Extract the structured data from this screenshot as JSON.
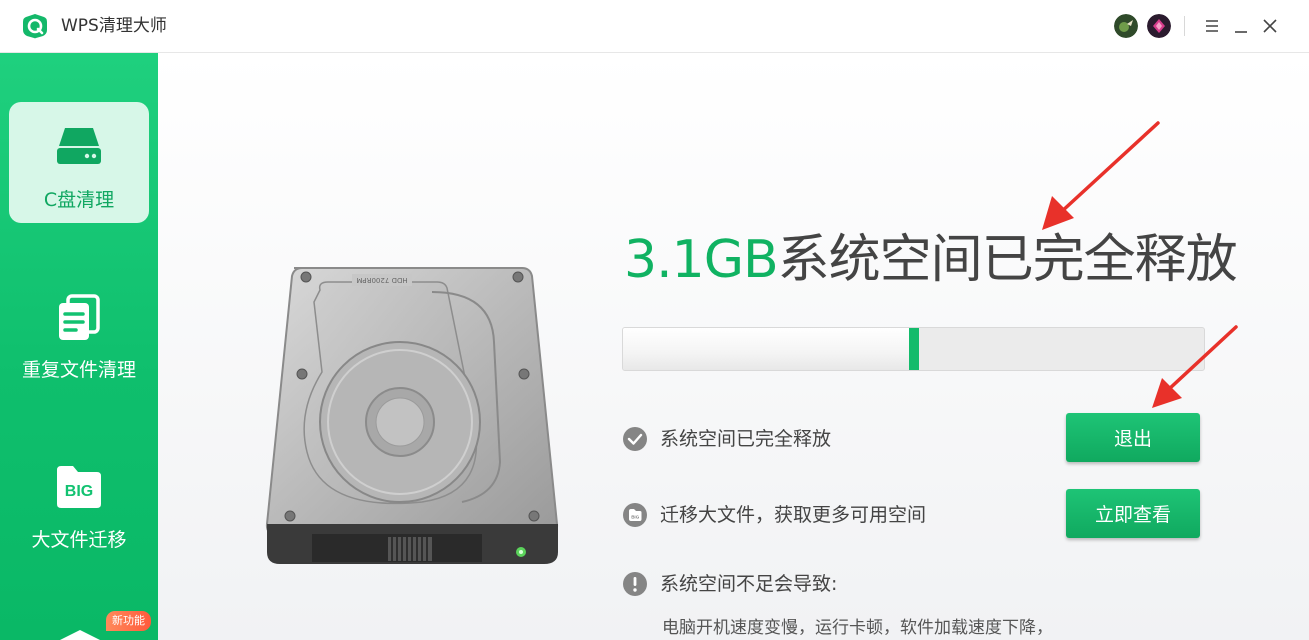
{
  "app": {
    "title": "WPS清理大师"
  },
  "sidebar": {
    "items": [
      {
        "label": "C盘清理",
        "icon": "disk-icon",
        "active": true
      },
      {
        "label": "重复文件清理",
        "icon": "duplicate-files-icon",
        "active": false
      },
      {
        "label": "大文件迁移",
        "icon": "big-file-icon",
        "icon_text": "BIG",
        "active": false
      }
    ],
    "new_badge": "新功能"
  },
  "main": {
    "headline_size": "3.1GB",
    "headline_text": "系统空间已完全释放",
    "progress_percent": 51,
    "status_items": [
      {
        "text": "系统空间已完全释放",
        "icon": "check-circle-icon"
      },
      {
        "text": "迁移大文件，获取更多可用空间",
        "icon": "big-file-small-icon"
      },
      {
        "text": "系统空间不足会导致:",
        "icon": "warning-circle-icon"
      }
    ],
    "exit_button": "退出",
    "view_button": "立即查看",
    "description": "电脑开机速度变慢，运行卡顿，软件加载速度下降，",
    "hdd_label": "HDD 7200RPM"
  },
  "colors": {
    "accent": "#10b262",
    "sidebar": "#0fbf6d",
    "arrow": "#e8312a"
  }
}
